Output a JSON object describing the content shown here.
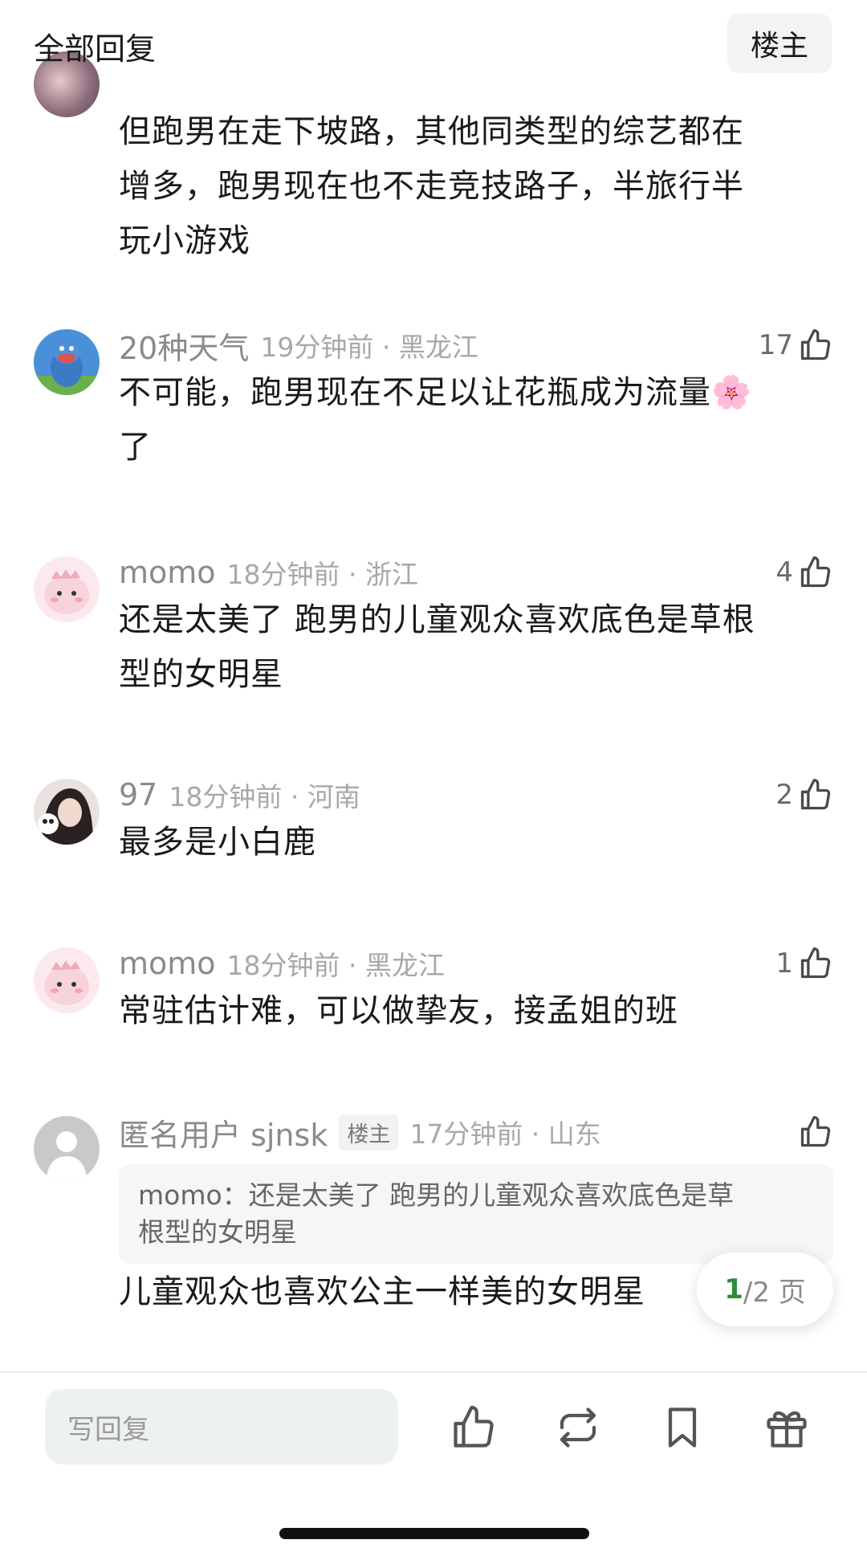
{
  "header": {
    "title": "全部回复",
    "op_filter": "楼主"
  },
  "comments": [
    {
      "text_lines": [
        "但跑男在走下坡路，其他同类型的综艺都在",
        "增多，跑男现在也不走竞技路子，半旅行半",
        "玩小游戏"
      ]
    },
    {
      "username": "20种天气",
      "time_loc": "19分钟前 · 黑龙江",
      "likes": "17",
      "text_lines": [
        "不可能，跑男现在不足以让花瓶成为流量🌸",
        "了"
      ]
    },
    {
      "username": "momo",
      "time_loc": "18分钟前 · 浙江",
      "likes": "4",
      "text_lines": [
        "还是太美了 跑男的儿童观众喜欢底色是草根",
        "型的女明星"
      ]
    },
    {
      "username": "97",
      "time_loc": "18分钟前 · 河南",
      "likes": "2",
      "text_lines": [
        "最多是小白鹿"
      ]
    },
    {
      "username": "momo",
      "time_loc": "18分钟前 · 黑龙江",
      "likes": "1",
      "text_lines": [
        "常驻估计难，可以做挚友，接孟姐的班"
      ]
    },
    {
      "username": "匿名用户 sjnsk",
      "badge": "楼主",
      "time_loc": "17分钟前 · 山东",
      "quote_lines": [
        "momo：还是太美了 跑男的儿童观众喜欢底色是草",
        "根型的女明星"
      ],
      "text_lines": [
        "儿童观众也喜欢公主一样美的女明星"
      ]
    }
  ],
  "pagination": {
    "current": "1",
    "total_suffix": "/2 页"
  },
  "bottom_bar": {
    "reply_placeholder": "写回复",
    "icons": [
      "thumbs-up-icon",
      "repost-icon",
      "bookmark-icon",
      "gift-icon"
    ]
  },
  "colors": {
    "accent_green": "#2e8b3e",
    "meta_gray": "#a8a8a8",
    "input_bg": "#eef2ee"
  }
}
